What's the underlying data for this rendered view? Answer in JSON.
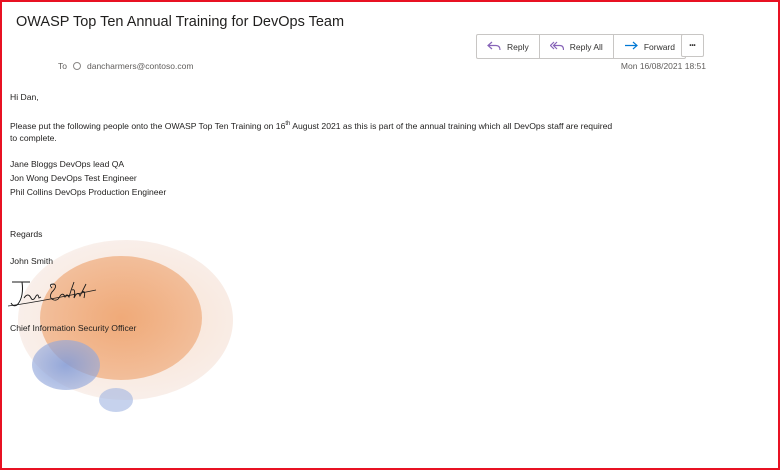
{
  "email": {
    "subject": "OWASP Top Ten Annual Training for DevOps Team",
    "to_label": "To",
    "to_address": "dancharmers@contoso.com",
    "date": "Mon 16/08/2021 18:51"
  },
  "actions": {
    "reply": "Reply",
    "reply_all": "Reply All",
    "forward": "Forward",
    "more": "•••"
  },
  "body": {
    "greeting": "Hi Dan,",
    "para_before": "Please put the following people onto the OWASP Top Ten Training on  16",
    "para_sup": "th",
    "para_after": " August 2021 as this is part of the annual training which all DevOps staff are required",
    "para_line2": "to complete.",
    "people": [
      "Jane Bloggs DevOps lead QA",
      "Jon Wong DevOps Test Engineer",
      "Phil Collins DevOps Production Engineer"
    ],
    "regards": "Regards",
    "sender_name": "John Smith",
    "sender_title": "Chief Information Security Officer"
  },
  "colors": {
    "frame": "#e81123",
    "reply_icon": "#8764b8",
    "forward_icon": "#0078d4",
    "blob_orange": "#eea976",
    "blob_blue": "#8fa5d8"
  },
  "icons": {
    "reply": "reply-icon",
    "reply_all": "reply-all-icon",
    "forward": "forward-icon",
    "more": "more-icon",
    "recipient": "contact-circle-icon"
  }
}
